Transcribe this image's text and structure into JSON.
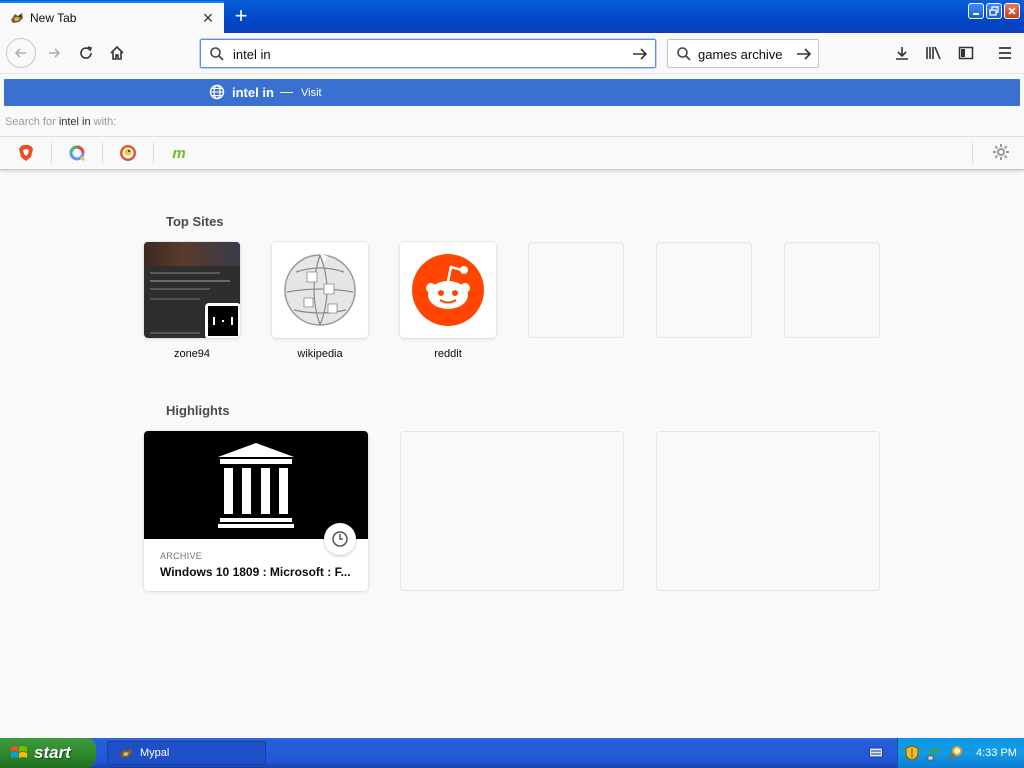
{
  "browser": {
    "tab": {
      "title": "New Tab",
      "close_glyph": "×"
    },
    "new_tab_glyph": "+",
    "url_bar": {
      "value": "intel in"
    },
    "search_bar": {
      "value": "games archive"
    }
  },
  "autocomplete": {
    "result_title": "intel in",
    "result_separator": "—",
    "result_action": "Visit",
    "search_with_prefix": "Search for ",
    "search_with_term": "intel in",
    "search_with_suffix": " with:",
    "engines": [
      "brave-icon",
      "qwant-icon",
      "duckduckgo-icon",
      "mojeek-icon"
    ],
    "mojeek_glyph": "m"
  },
  "newtab": {
    "top_sites_title": "Top Sites",
    "top_sites": [
      {
        "label": "zone94"
      },
      {
        "label": "wikipedia"
      },
      {
        "label": "reddit"
      }
    ],
    "highlights_title": "Highlights",
    "highlight": {
      "source": "ARCHIVE",
      "title": "Windows 10 1809 : Microsoft : F..."
    }
  },
  "taskbar": {
    "start_label": "start",
    "task_label": "Mypal",
    "clock": "4:33 PM"
  },
  "colors": {
    "accent": "#0a84ff",
    "autocomplete_highlight": "#3a70d0",
    "reddit": "#ff4500",
    "taskbar": "#245edb"
  }
}
